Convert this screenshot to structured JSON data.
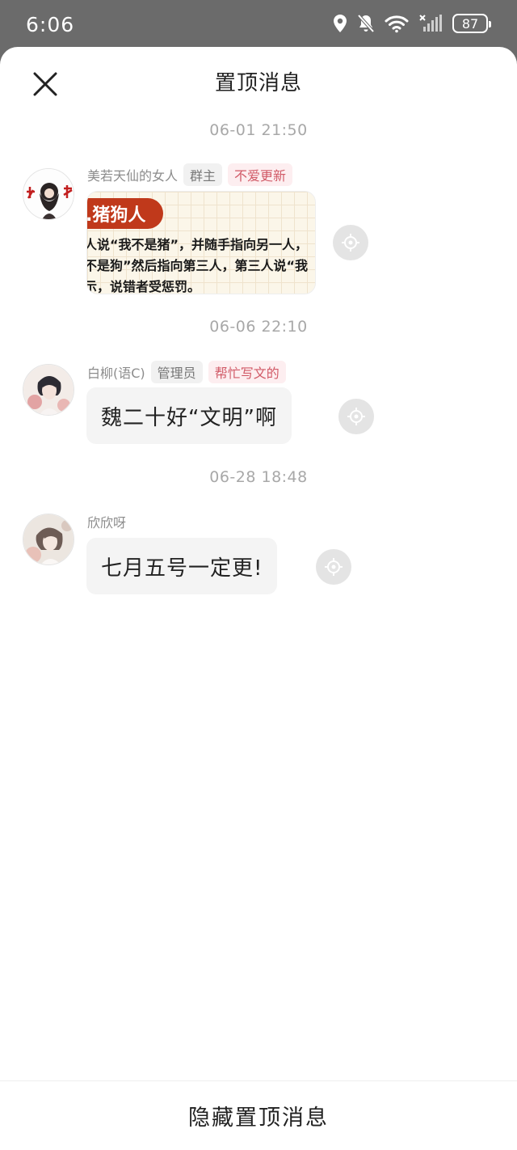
{
  "status_bar": {
    "time": "6:06",
    "battery": "87",
    "icons": [
      "location-icon",
      "bell-off-icon",
      "wifi-icon",
      "signal-icon",
      "battery-icon"
    ]
  },
  "header": {
    "title": "置顶消息",
    "close_icon": "close-icon"
  },
  "messages": [
    {
      "timestamp": "06-01 21:50",
      "nickname": "美若天仙的女人",
      "role_tag": "群主",
      "title_tag": "不爱更新",
      "type": "image",
      "image": {
        "banner": ".猪狗人",
        "lines": [
          "人说“我不是猪”，并随手指向另一人，",
          "不是狗”然后指向第三人，第三人说“我",
          "示，说错者受惩罚。"
        ]
      }
    },
    {
      "timestamp": "06-06 22:10",
      "nickname": "白柳(语C)",
      "role_tag": "管理员",
      "title_tag": "帮忙写文的",
      "type": "text",
      "text": "魏二十好“文明”啊"
    },
    {
      "timestamp": "06-28 18:48",
      "nickname": "欣欣呀",
      "type": "text",
      "text": "七月五号一定更!"
    }
  ],
  "footer": {
    "button_label": "隐藏置顶消息"
  },
  "colors": {
    "overlay": "#6b6b6b",
    "sheet": "#ffffff",
    "bubble": "#f4f4f4",
    "tag_red_text": "#d15a67",
    "tag_red_bg": "#fdeef0",
    "timestamp": "#a8a8a8"
  }
}
